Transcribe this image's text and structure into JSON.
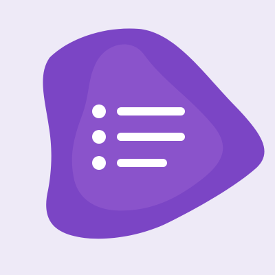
{
  "icon": {
    "name": "list-icon",
    "background_color": "#eeeaf7",
    "outer_blob_color": "#7b45c5",
    "inner_blob_color": "#8a53cb",
    "glyph_color": "#ffffff",
    "list_rows": 3
  }
}
